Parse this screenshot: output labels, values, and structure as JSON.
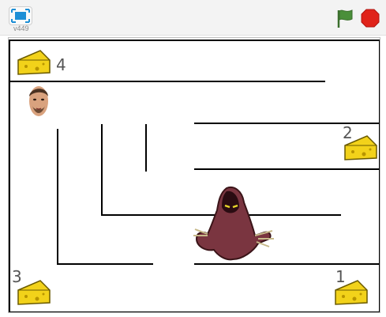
{
  "toolbar": {
    "version": "v449",
    "fullscreen_icon": "fullscreen-icon",
    "flag_icon": "green-flag-icon",
    "stop_icon": "stop-icon",
    "flag_color": "#4a8f3a",
    "stop_color": "#e0231a"
  },
  "stage": {
    "cheeses": [
      {
        "label": "4",
        "icon": "cheese-icon"
      },
      {
        "label": "2",
        "icon": "cheese-icon"
      },
      {
        "label": "3",
        "icon": "cheese-icon"
      },
      {
        "label": "1",
        "icon": "cheese-icon"
      }
    ],
    "player_icon": "face-icon",
    "enemy_icon": "hooded-ghost-icon",
    "wall_color": "#000000",
    "cheese_color": "#f2d21a"
  }
}
